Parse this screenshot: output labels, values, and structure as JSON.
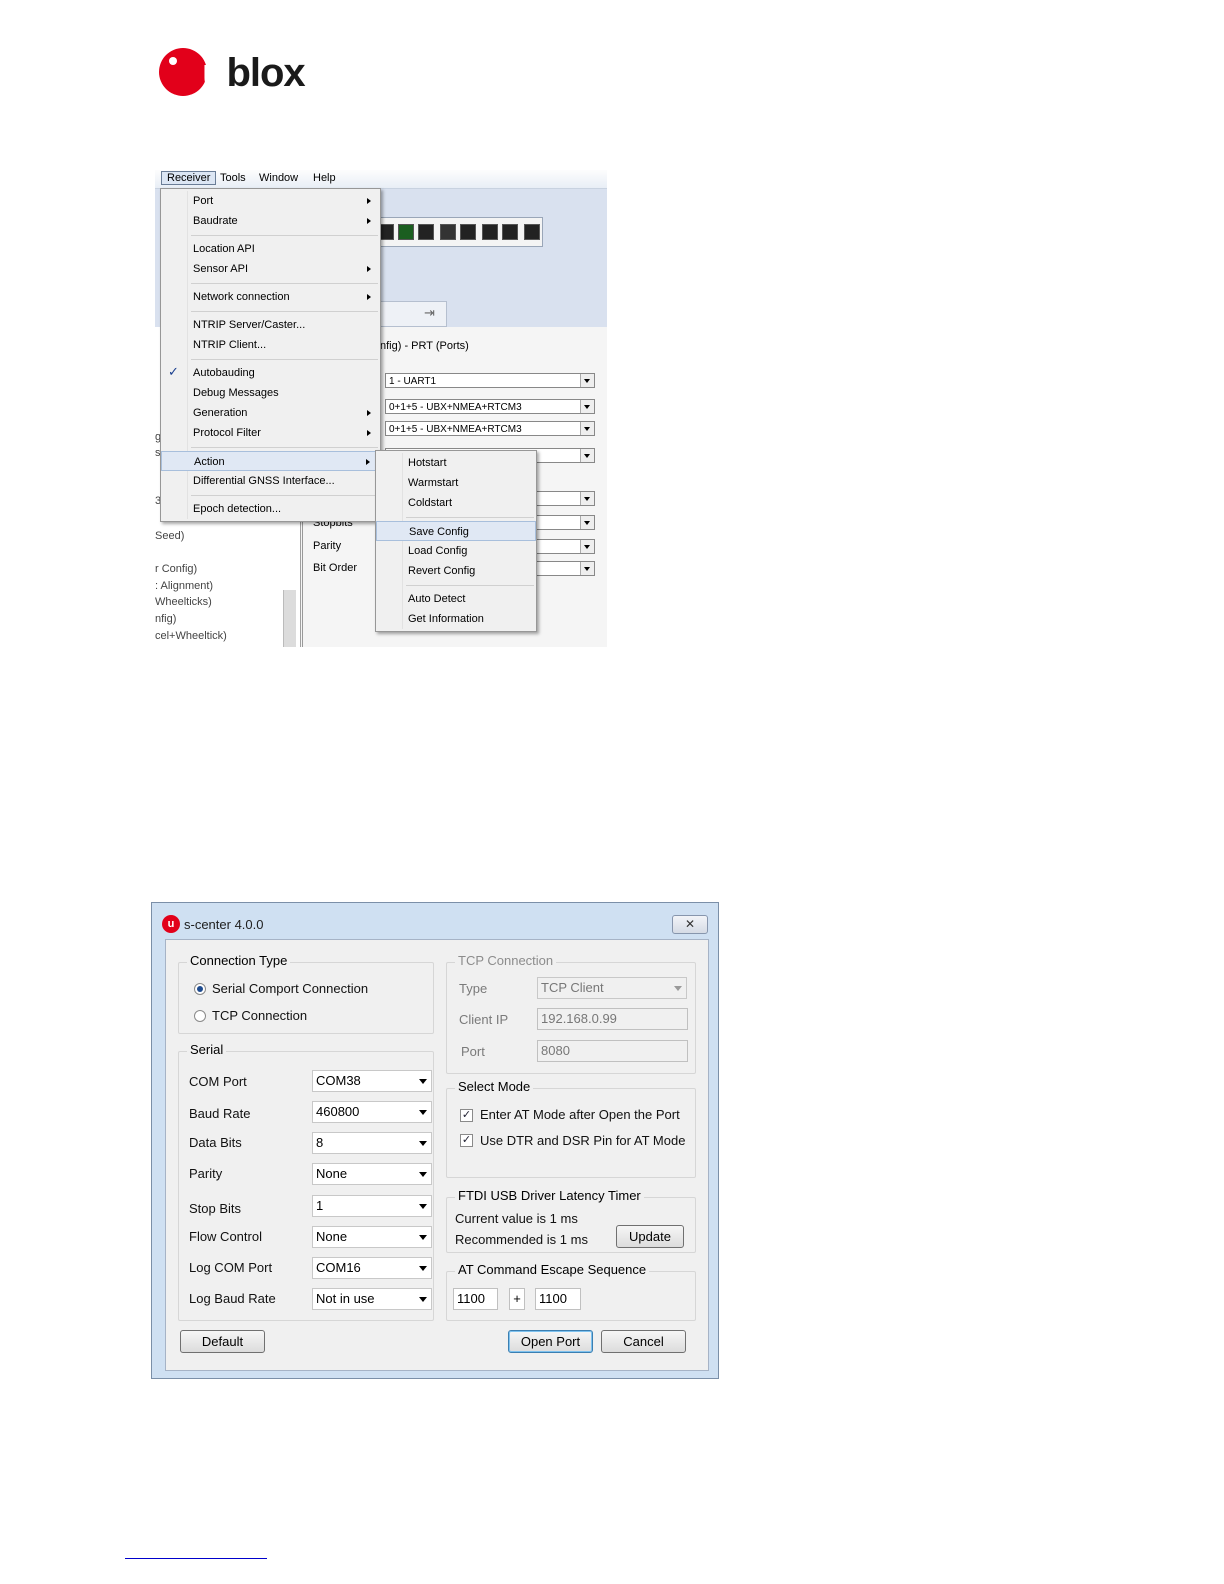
{
  "logo": {
    "text": "ublox"
  },
  "menu_screenshot": {
    "menubar": [
      "Receiver",
      "Tools",
      "Window",
      "Help"
    ],
    "receiver_menu": [
      {
        "label": "Port",
        "submenu": true
      },
      {
        "label": "Baudrate",
        "submenu": true
      },
      {
        "label": "Location API",
        "submenu": false
      },
      {
        "label": "Sensor API",
        "submenu": true
      },
      {
        "label": "Network connection",
        "submenu": true
      },
      {
        "label": "NTRIP Server/Caster...",
        "submenu": false
      },
      {
        "label": "NTRIP Client...",
        "submenu": false
      },
      {
        "label": "Autobauding",
        "submenu": false,
        "checked": true
      },
      {
        "label": "Debug Messages",
        "submenu": false
      },
      {
        "label": "Generation",
        "submenu": true
      },
      {
        "label": "Protocol Filter",
        "submenu": true
      },
      {
        "label": "Action",
        "submenu": true,
        "highlighted": true
      },
      {
        "label": "Differential GNSS Interface...",
        "submenu": false
      },
      {
        "label": "Epoch detection...",
        "submenu": false
      }
    ],
    "action_submenu": [
      {
        "label": "Hotstart"
      },
      {
        "label": "Warmstart"
      },
      {
        "label": "Coldstart"
      },
      {
        "label": "Save Config",
        "highlighted": true
      },
      {
        "label": "Load Config"
      },
      {
        "label": "Revert Config"
      },
      {
        "label": "Auto Detect"
      },
      {
        "label": "Get Information"
      }
    ],
    "panel_title": "nfig) - PRT (Ports)",
    "combos": [
      "1 - UART1",
      "0+1+5 - UBX+NMEA+RTCM3",
      "0+1+5 - UBX+NMEA+RTCM3"
    ],
    "panel_labels": [
      "Stopbits",
      "Parity",
      "Bit Order"
    ],
    "left_tree_fragments": [
      "g",
      "s",
      "3",
      "Seed)",
      "r Config)",
      ": Alignment)",
      "Wheelticks)",
      "nfig)",
      "cel+Wheeltick)"
    ]
  },
  "dialog": {
    "title": "s-center 4.0.0",
    "close_symbol": "✕",
    "connection_type": {
      "title": "Connection Type",
      "options": [
        {
          "label": "Serial Comport Connection",
          "selected": true
        },
        {
          "label": "TCP Connection",
          "selected": false
        }
      ]
    },
    "serial": {
      "title": "Serial",
      "fields": [
        {
          "label": "COM Port",
          "value": "COM38"
        },
        {
          "label": "Baud Rate",
          "value": "460800"
        },
        {
          "label": "Data Bits",
          "value": "8"
        },
        {
          "label": "Parity",
          "value": "None"
        },
        {
          "label": "Stop Bits",
          "value": "1"
        },
        {
          "label": "Flow Control",
          "value": "None"
        },
        {
          "label": "Log COM Port",
          "value": "COM16"
        },
        {
          "label": "Log Baud Rate",
          "value": "Not in use"
        }
      ]
    },
    "tcp": {
      "title": "TCP Connection",
      "type_label": "Type",
      "type_value": "TCP Client",
      "ip_label": "Client IP",
      "ip_value": "192.168.0.99",
      "port_label": "Port",
      "port_value": "8080"
    },
    "select_mode": {
      "title": "Select Mode",
      "options": [
        {
          "label": "Enter AT Mode after Open the Port",
          "checked": true
        },
        {
          "label": "Use DTR and DSR Pin for AT Mode",
          "checked": true
        }
      ]
    },
    "ftdi": {
      "title": "FTDI USB Driver Latency Timer",
      "current": "Current value is 1 ms",
      "recommended": "Recommended is 1 ms",
      "update_button": "Update"
    },
    "escape": {
      "title": "AT Command Escape Sequence",
      "first": "1100",
      "plus": "+",
      "second": "1100"
    },
    "buttons": {
      "default": "Default",
      "open_port": "Open Port",
      "cancel": "Cancel"
    }
  }
}
